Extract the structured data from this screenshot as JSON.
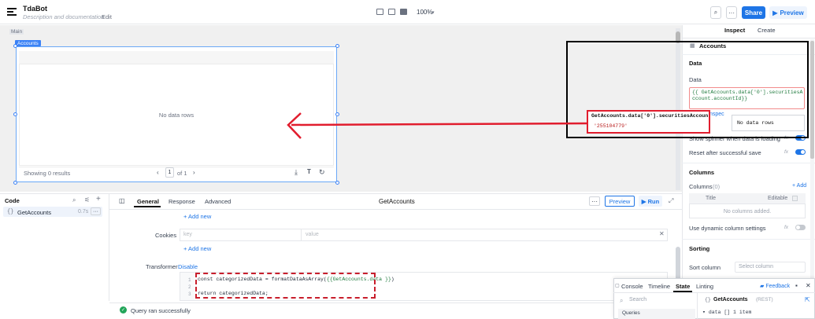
{
  "header": {
    "app_name": "TdaBot",
    "description_placeholder": "Description and documentation",
    "edit_label": "Edit",
    "zoom": "100%",
    "share_label": "Share",
    "preview_label": "Preview"
  },
  "canvas": {
    "main_label": "Main",
    "widget_tag": "Accounts",
    "empty_text": "No data rows",
    "showing_text": "Showing 0 results",
    "page_value": "1",
    "page_of": "of 1"
  },
  "annotation": {
    "popup_title": "GetAccounts.data['0'].securitiesAccount…",
    "popup_value": "'255104779'",
    "colors": {
      "box": "#000000",
      "arrow": "#e11d2e"
    }
  },
  "inspector": {
    "tabs": [
      "Inspect",
      "Create"
    ],
    "component_name": "Accounts",
    "data_section": "Data",
    "data_label": "Data",
    "data_code": "{{ GetAccounts.data['0'].securitiesAccount.accountId}}",
    "inspect_link": "Inspec",
    "nodata_popup": "No data rows",
    "show_spinner": "Show spinner when data is loading",
    "reset_after_save": "Reset after successful save",
    "columns_section": "Columns",
    "columns_label": "Columns",
    "columns_count": "(0)",
    "add_label": "+ Add",
    "col_title": "Title",
    "col_editable": "Editable",
    "no_columns": "No columns added.",
    "dynamic_settings": "Use dynamic column settings",
    "sorting_section": "Sorting",
    "sort_column_label": "Sort column",
    "sort_placeholder": "Select column",
    "fx": "fx"
  },
  "code_panel": {
    "title": "Code",
    "query_name": "GetAccounts",
    "query_time": "0.7s",
    "tabs": [
      "General",
      "Response",
      "Advanced"
    ],
    "query_title": "GetAccounts",
    "preview_label": "Preview",
    "run_label": "Run",
    "add_new": "+ Add new",
    "cookies_label": "Cookies",
    "key_placeholder": "key",
    "value_placeholder": "value",
    "transformer_label": "Transformer",
    "disable_label": "Disable",
    "code_lines": {
      "l1_pre": "const categorizedData = formatDataAsArray(",
      "l1_tmpl": "{{GetAccounts.data }}",
      "l1_post": ")",
      "l3": "return categorizedData;"
    },
    "line_numbers": [
      "1",
      "2",
      "3"
    ],
    "status": "Query ran successfully"
  },
  "console": {
    "tabs": [
      "Console",
      "Timeline",
      "State",
      "Linting"
    ],
    "feedback": "Feedback",
    "search_placeholder": "Search",
    "queries_label": "Queries",
    "object_name": "GetAccounts",
    "object_type": "(REST)",
    "data_row": "▾ data  [] 1 item"
  }
}
